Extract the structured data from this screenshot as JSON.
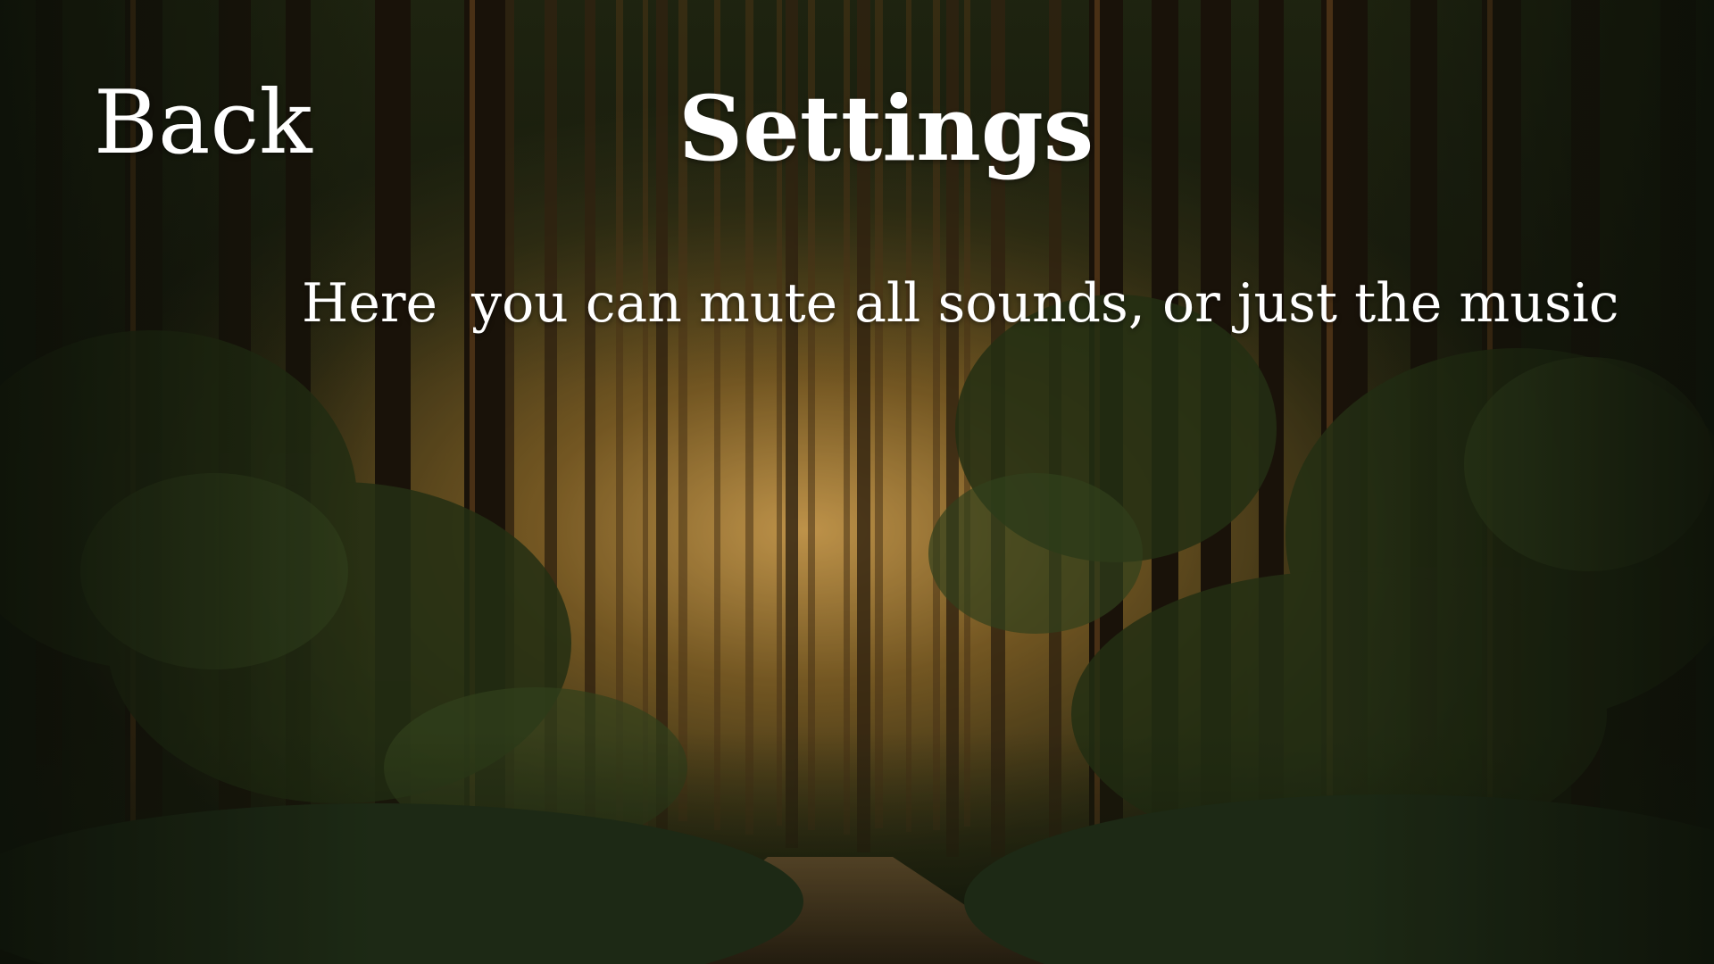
{
  "nav": {
    "back_label": "Back"
  },
  "header": {
    "title": "Settings"
  },
  "description": {
    "text": "Here  you can mute all sounds, or just the music"
  },
  "colors": {
    "text": "#ffffff",
    "forest_light": "#e8b35a",
    "forest_dark": "#1d2010"
  },
  "background": {
    "icon": "forest-path-image"
  }
}
